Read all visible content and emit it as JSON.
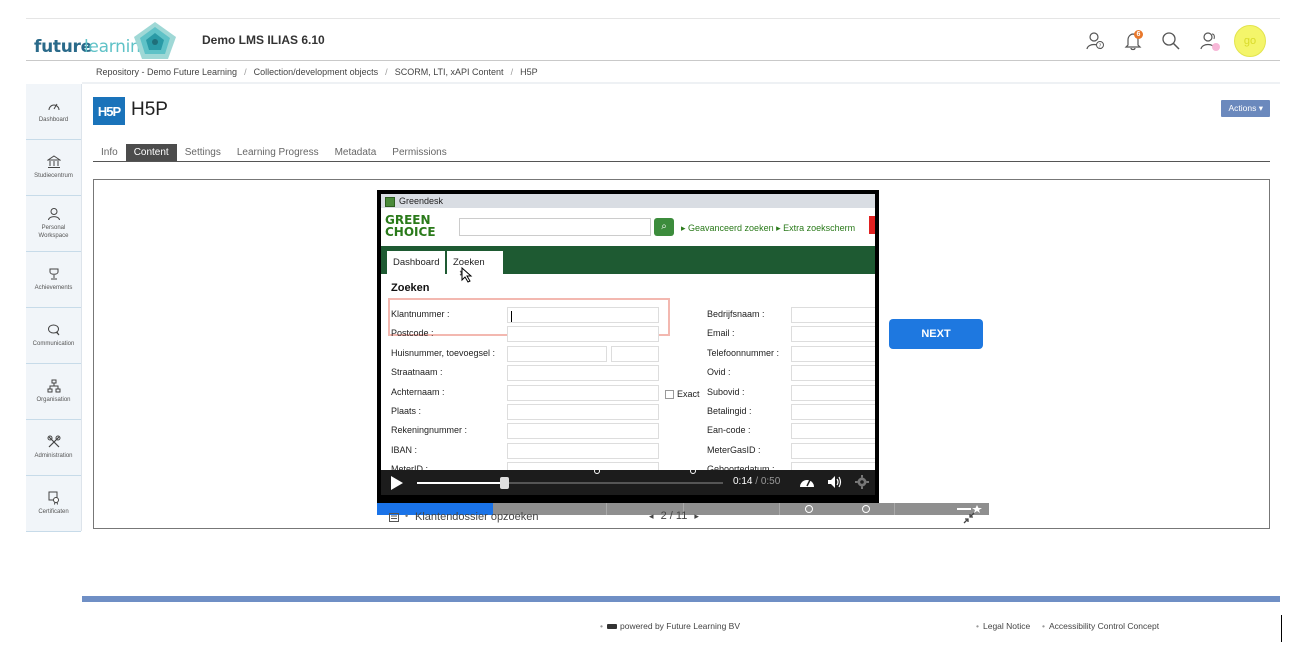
{
  "header": {
    "logo_future": "future",
    "logo_learning": "learning",
    "site_title": "Demo LMS ILIAS 6.10",
    "notification_count": "6",
    "avatar_initials": "go"
  },
  "breadcrumb": [
    "Repository - Demo Future Learning",
    "Collection/development objects",
    "SCORM, LTI, xAPI Content",
    "H5P"
  ],
  "sidebar": {
    "items": [
      {
        "label": "Dashboard",
        "icon": "dashboard-icon"
      },
      {
        "label": "Studiecentrum",
        "icon": "bank-icon"
      },
      {
        "label": "Personal Workspace",
        "icon": "user-icon"
      },
      {
        "label": "Achievements",
        "icon": "trophy-icon"
      },
      {
        "label": "Communication",
        "icon": "chat-icon"
      },
      {
        "label": "Organisation",
        "icon": "org-icon"
      },
      {
        "label": "Administration",
        "icon": "tools-icon"
      },
      {
        "label": "Certificaten",
        "icon": "certificate-icon"
      }
    ]
  },
  "title": {
    "logo_text": "H5P",
    "text": "H5P",
    "actions_label": "Actions ▾"
  },
  "tabs": [
    {
      "label": "Info",
      "active": false
    },
    {
      "label": "Content",
      "active": true
    },
    {
      "label": "Settings",
      "active": false
    },
    {
      "label": "Learning Progress",
      "active": false
    },
    {
      "label": "Metadata",
      "active": false
    },
    {
      "label": "Permissions",
      "active": false
    }
  ],
  "video": {
    "window_title": "Greendesk",
    "brand_line1": "GREEN",
    "brand_line2": "CHOICE",
    "links": "▸ Geavanceerd zoeken ▸ Extra zoekscherm",
    "tab_dashboard": "Dashboard",
    "tab_zoeken": "Zoeken",
    "tab_close": "✖",
    "section_title": "Zoeken",
    "left_labels": [
      "Klantnummer :",
      "Postcode :",
      "Huisnummer, toevoegsel :",
      "Straatnaam :",
      "Achternaam :",
      "Plaats :",
      "Rekeningnummer :",
      "IBAN :",
      "MeterID :"
    ],
    "right_labels": [
      "Bedrijfsnaam :",
      "Email :",
      "Telefoonnummer :",
      "Ovid :",
      "Subovid :",
      "Betalingid :",
      "Ean-code :",
      "MeterGasID :",
      "Geboortedatum :"
    ],
    "exact_label": "Exact",
    "time_current": "0:14",
    "time_duration": "0:50",
    "progress_fraction": 0.28
  },
  "slides": {
    "next_label": "NEXT",
    "slide_title": "Klantendossier opzoeken",
    "current": "2",
    "total": "11",
    "progress_fraction": 0.19
  },
  "footer": {
    "powered_by": "powered by Future Learning BV",
    "legal_notice": "Legal Notice",
    "accessibility": "Accessibility Control Concept"
  }
}
